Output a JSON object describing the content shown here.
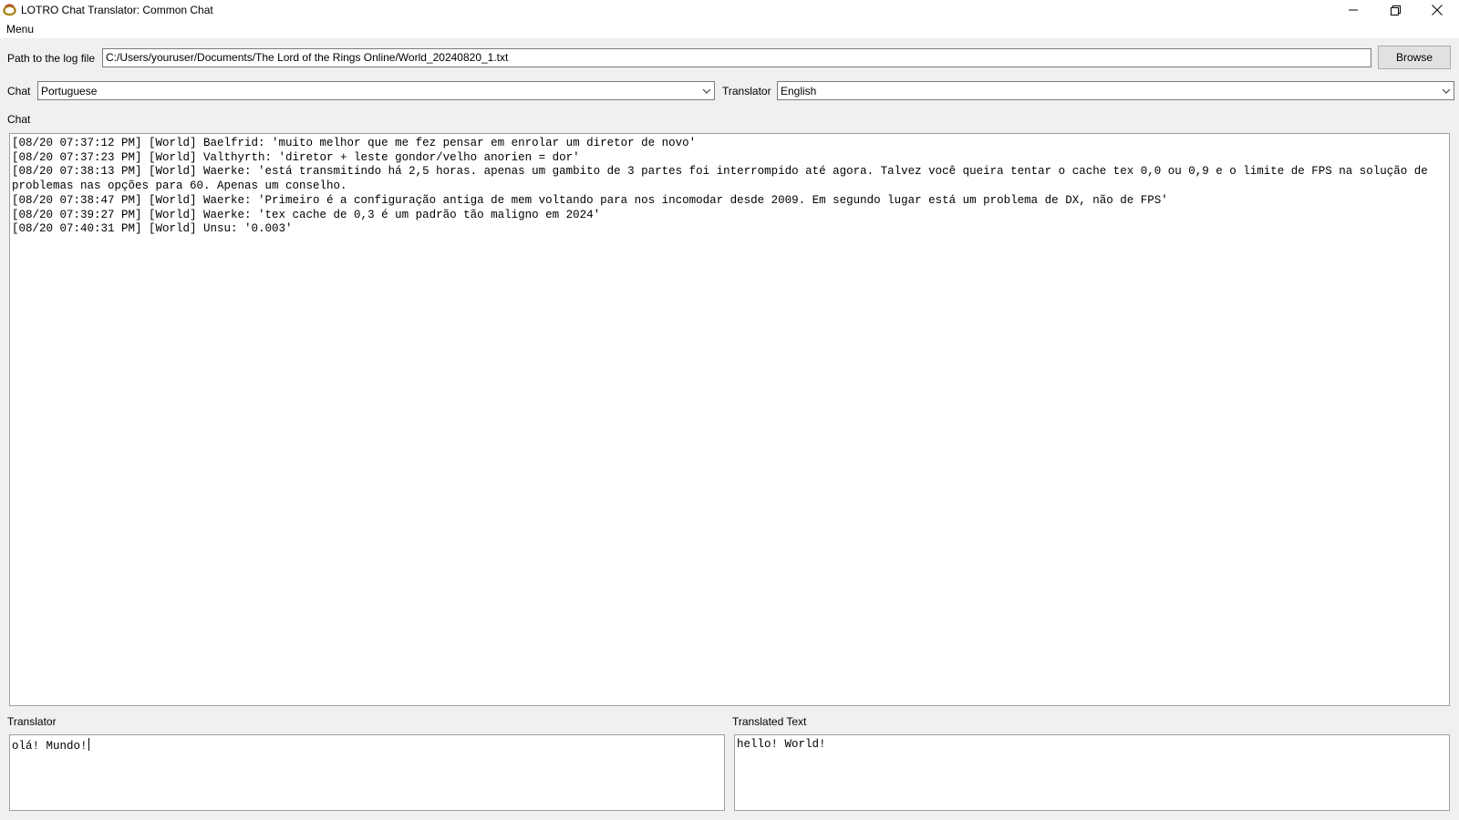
{
  "window": {
    "title": "LOTRO Chat Translator: Common Chat",
    "icon": "ring-icon",
    "controls": [
      "minimize-icon",
      "restore-icon",
      "close-icon"
    ]
  },
  "menu": {
    "label": "Menu"
  },
  "log_path": {
    "label": "Path to the log file",
    "value": "C:/Users/youruser/Documents/The Lord of the Rings Online/World_20240820_1.txt",
    "browse_label": "Browse"
  },
  "chat_select": {
    "label": "Chat",
    "value": "Portuguese"
  },
  "translator_select": {
    "label": "Translator",
    "value": "English"
  },
  "chat": {
    "label": "Chat",
    "lines": [
      "[08/20 07:37:12 PM] [World] Baelfrid: 'muito melhor que me fez pensar em enrolar um diretor de novo'",
      "[08/20 07:37:23 PM] [World] Valthyrth: 'diretor + leste gondor/velho anorien = dor'",
      "[08/20 07:38:13 PM] [World] Waerke: 'está transmitindo há 2,5 horas. apenas um gambito de 3 partes foi interrompido até agora. Talvez você queira tentar o cache tex 0,0 ou 0,9 e o limite de FPS na solução de problemas nas opções para 60. Apenas um conselho.",
      "[08/20 07:38:47 PM] [World] Waerke: 'Primeiro é a configuração antiga de mem voltando para nos incomodar desde 2009. Em segundo lugar está um problema de DX, não de FPS'",
      "[08/20 07:39:27 PM] [World] Waerke: 'tex cache de 0,3 é um padrão tão maligno em 2024'",
      "[08/20 07:40:31 PM] [World] Unsu: '0.003'"
    ]
  },
  "translator_input": {
    "label": "Translator",
    "value": "olá! Mundo!"
  },
  "translated_output": {
    "label": "Translated Text",
    "value": "hello! World!"
  }
}
